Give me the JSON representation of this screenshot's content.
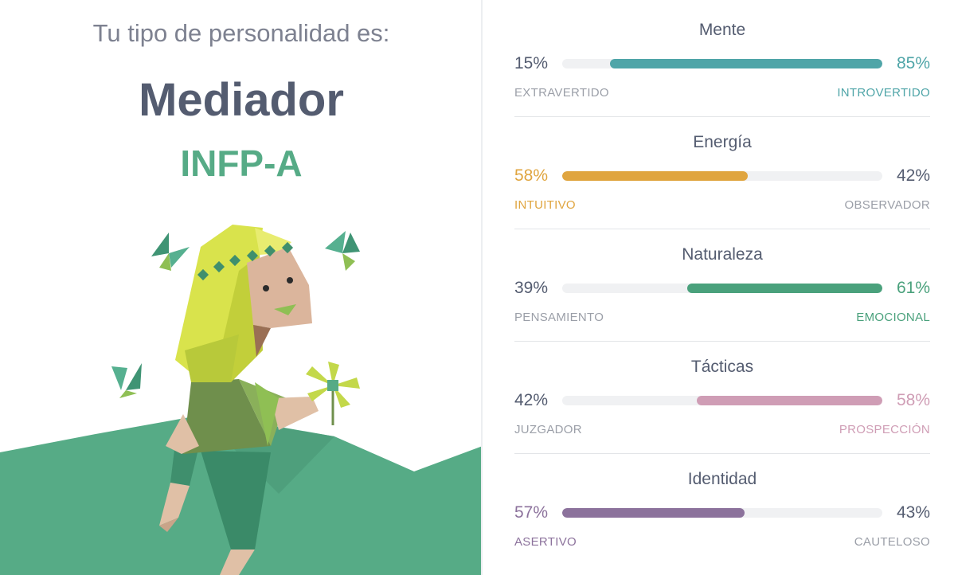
{
  "result": {
    "subtitle": "Tu tipo de personalidad es:",
    "name": "Mediador",
    "code": "INFP-A",
    "code_color": "#56ab86"
  },
  "traits": [
    {
      "title": "Mente",
      "left_pct": "15%",
      "right_pct": "85%",
      "left_label": "EXTRAVERTIDO",
      "right_label": "INTROVERTIDO",
      "dominant": "right",
      "dominant_value": 85,
      "color": "#4fa5a8"
    },
    {
      "title": "Energía",
      "left_pct": "58%",
      "right_pct": "42%",
      "left_label": "INTUITIVO",
      "right_label": "OBSERVADOR",
      "dominant": "left",
      "dominant_value": 58,
      "color": "#e0a53f"
    },
    {
      "title": "Naturaleza",
      "left_pct": "39%",
      "right_pct": "61%",
      "left_label": "PENSAMIENTO",
      "right_label": "EMOCIONAL",
      "dominant": "right",
      "dominant_value": 61,
      "color": "#4aa17c"
    },
    {
      "title": "Tácticas",
      "left_pct": "42%",
      "right_pct": "58%",
      "left_label": "JUZGADOR",
      "right_label": "PROSPECCIÓN",
      "dominant": "right",
      "dominant_value": 58,
      "color": "#cf9db5"
    },
    {
      "title": "Identidad",
      "left_pct": "57%",
      "right_pct": "43%",
      "left_label": "ASERTIVO",
      "right_label": "CAUTELOSO",
      "dominant": "left",
      "dominant_value": 57,
      "color": "#8c729c"
    }
  ],
  "illustration": {
    "icon": "mediator-character-illustration"
  }
}
